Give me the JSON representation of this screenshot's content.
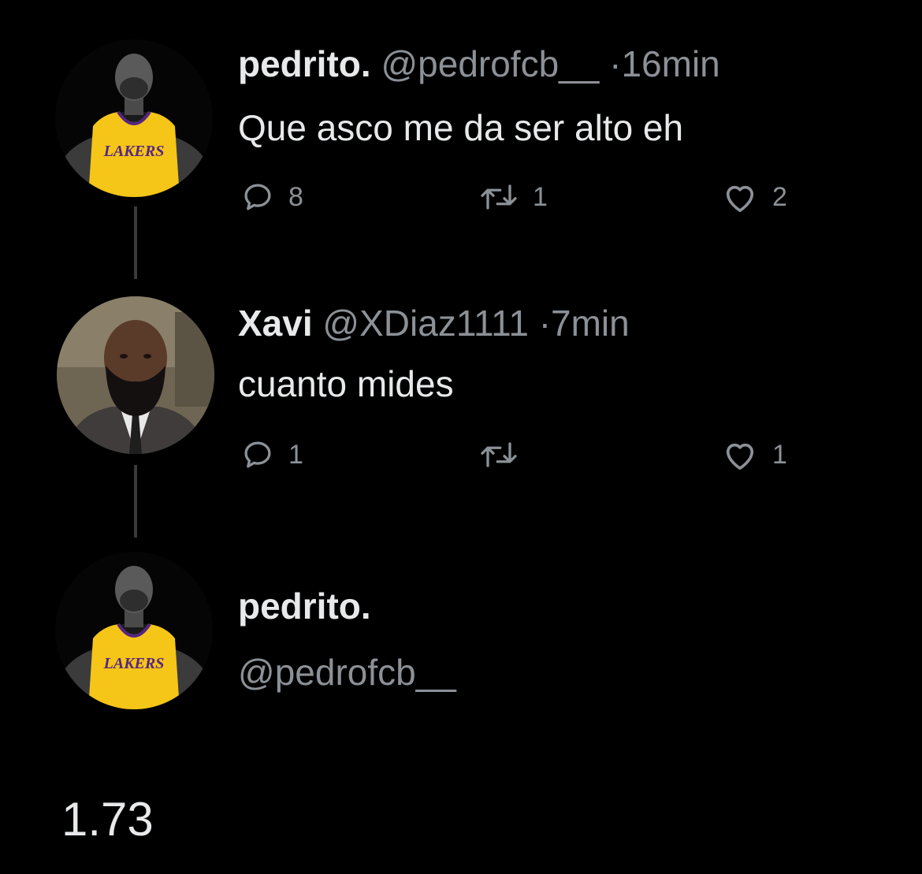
{
  "tweets": [
    {
      "name": "pedrito.",
      "handle": "@pedrofcb__",
      "separator": "·",
      "time": "16min",
      "text": "Que asco me da ser alto eh",
      "replies": "8",
      "retweets": "1",
      "likes": "2",
      "avatar_icon": "lakers-player-avatar",
      "avatar_logo_text": "LAKERS"
    },
    {
      "name": "Xavi",
      "handle": "@XDiaz1111",
      "separator": "·",
      "time": "7min",
      "text": "cuanto mides",
      "replies": "1",
      "retweets": "",
      "likes": "1",
      "avatar_icon": "bearded-man-avatar"
    }
  ],
  "reply_composer": {
    "name": "pedrito.",
    "handle": "@pedrofcb__",
    "avatar_icon": "lakers-player-avatar",
    "avatar_logo_text": "LAKERS",
    "text": "1.73"
  },
  "colors": {
    "background": "#000000",
    "primary_text": "#e7e9ea",
    "secondary_text": "#8b9196",
    "jersey_gold": "#f5c518",
    "jersey_purple": "#552583"
  }
}
